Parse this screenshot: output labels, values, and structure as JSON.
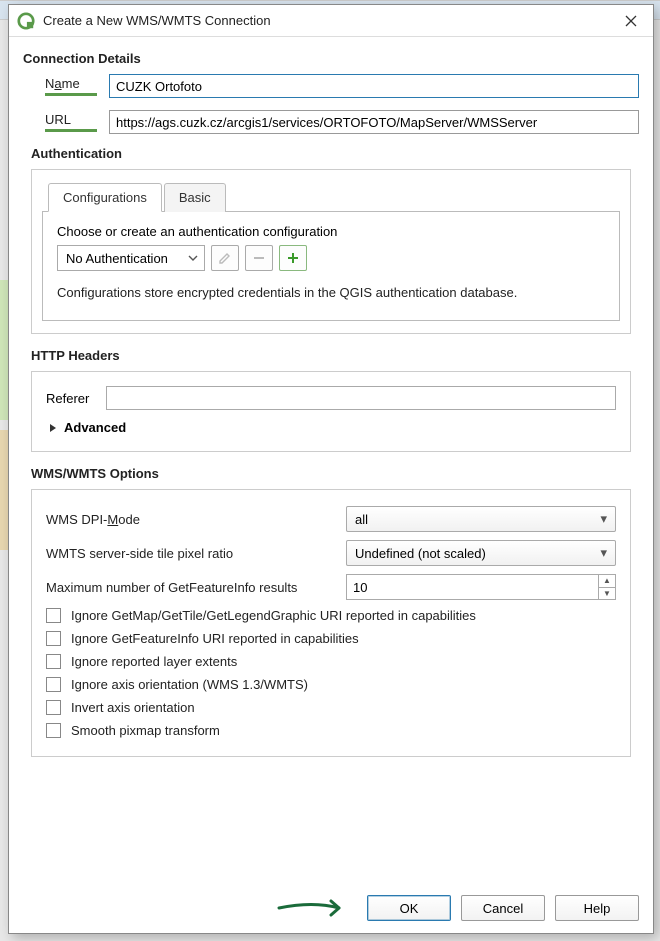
{
  "window": {
    "title": "Create a New WMS/WMTS Connection"
  },
  "section_connection": "Connection Details",
  "name_field": {
    "label_pre": "N",
    "label_ul": "a",
    "label_post": "me",
    "value": "CUZK Ortofoto"
  },
  "url_field": {
    "label": "URL",
    "value": "https://ags.cuzk.cz/arcgis1/services/ORTOFOTO/MapServer/WMSServer"
  },
  "auth": {
    "title": "Authentication",
    "tabs": {
      "configurations": "Configurations",
      "basic": "Basic"
    },
    "choose_label": "Choose or create an authentication configuration",
    "combo_value": "No Authentication",
    "hint": "Configurations store encrypted credentials in the QGIS authentication database."
  },
  "http": {
    "title": "HTTP Headers",
    "referer_label": "Referer",
    "referer_value": "",
    "advanced": "Advanced"
  },
  "wms": {
    "title": "WMS/WMTS Options",
    "dpi_pre": "WMS DPI-",
    "dpi_ul": "M",
    "dpi_post": "ode",
    "dpi_value": "all",
    "ratio_label": "WMTS server-side tile pixel ratio",
    "ratio_value": "Undefined (not scaled)",
    "max_label": "Maximum number of GetFeatureInfo results",
    "max_value": "10",
    "cb1": "Ignore GetMap/GetTile/GetLegendGraphic URI reported in capabilities",
    "cb2": "Ignore GetFeatureInfo URI reported in capabilities",
    "cb3": "Ignore reported layer extents",
    "cb4": "Ignore axis orientation (WMS 1.3/WMTS)",
    "cb5": "Invert axis orientation",
    "cb6": "Smooth pixmap transform"
  },
  "buttons": {
    "ok": "OK",
    "cancel": "Cancel",
    "help": "Help"
  }
}
